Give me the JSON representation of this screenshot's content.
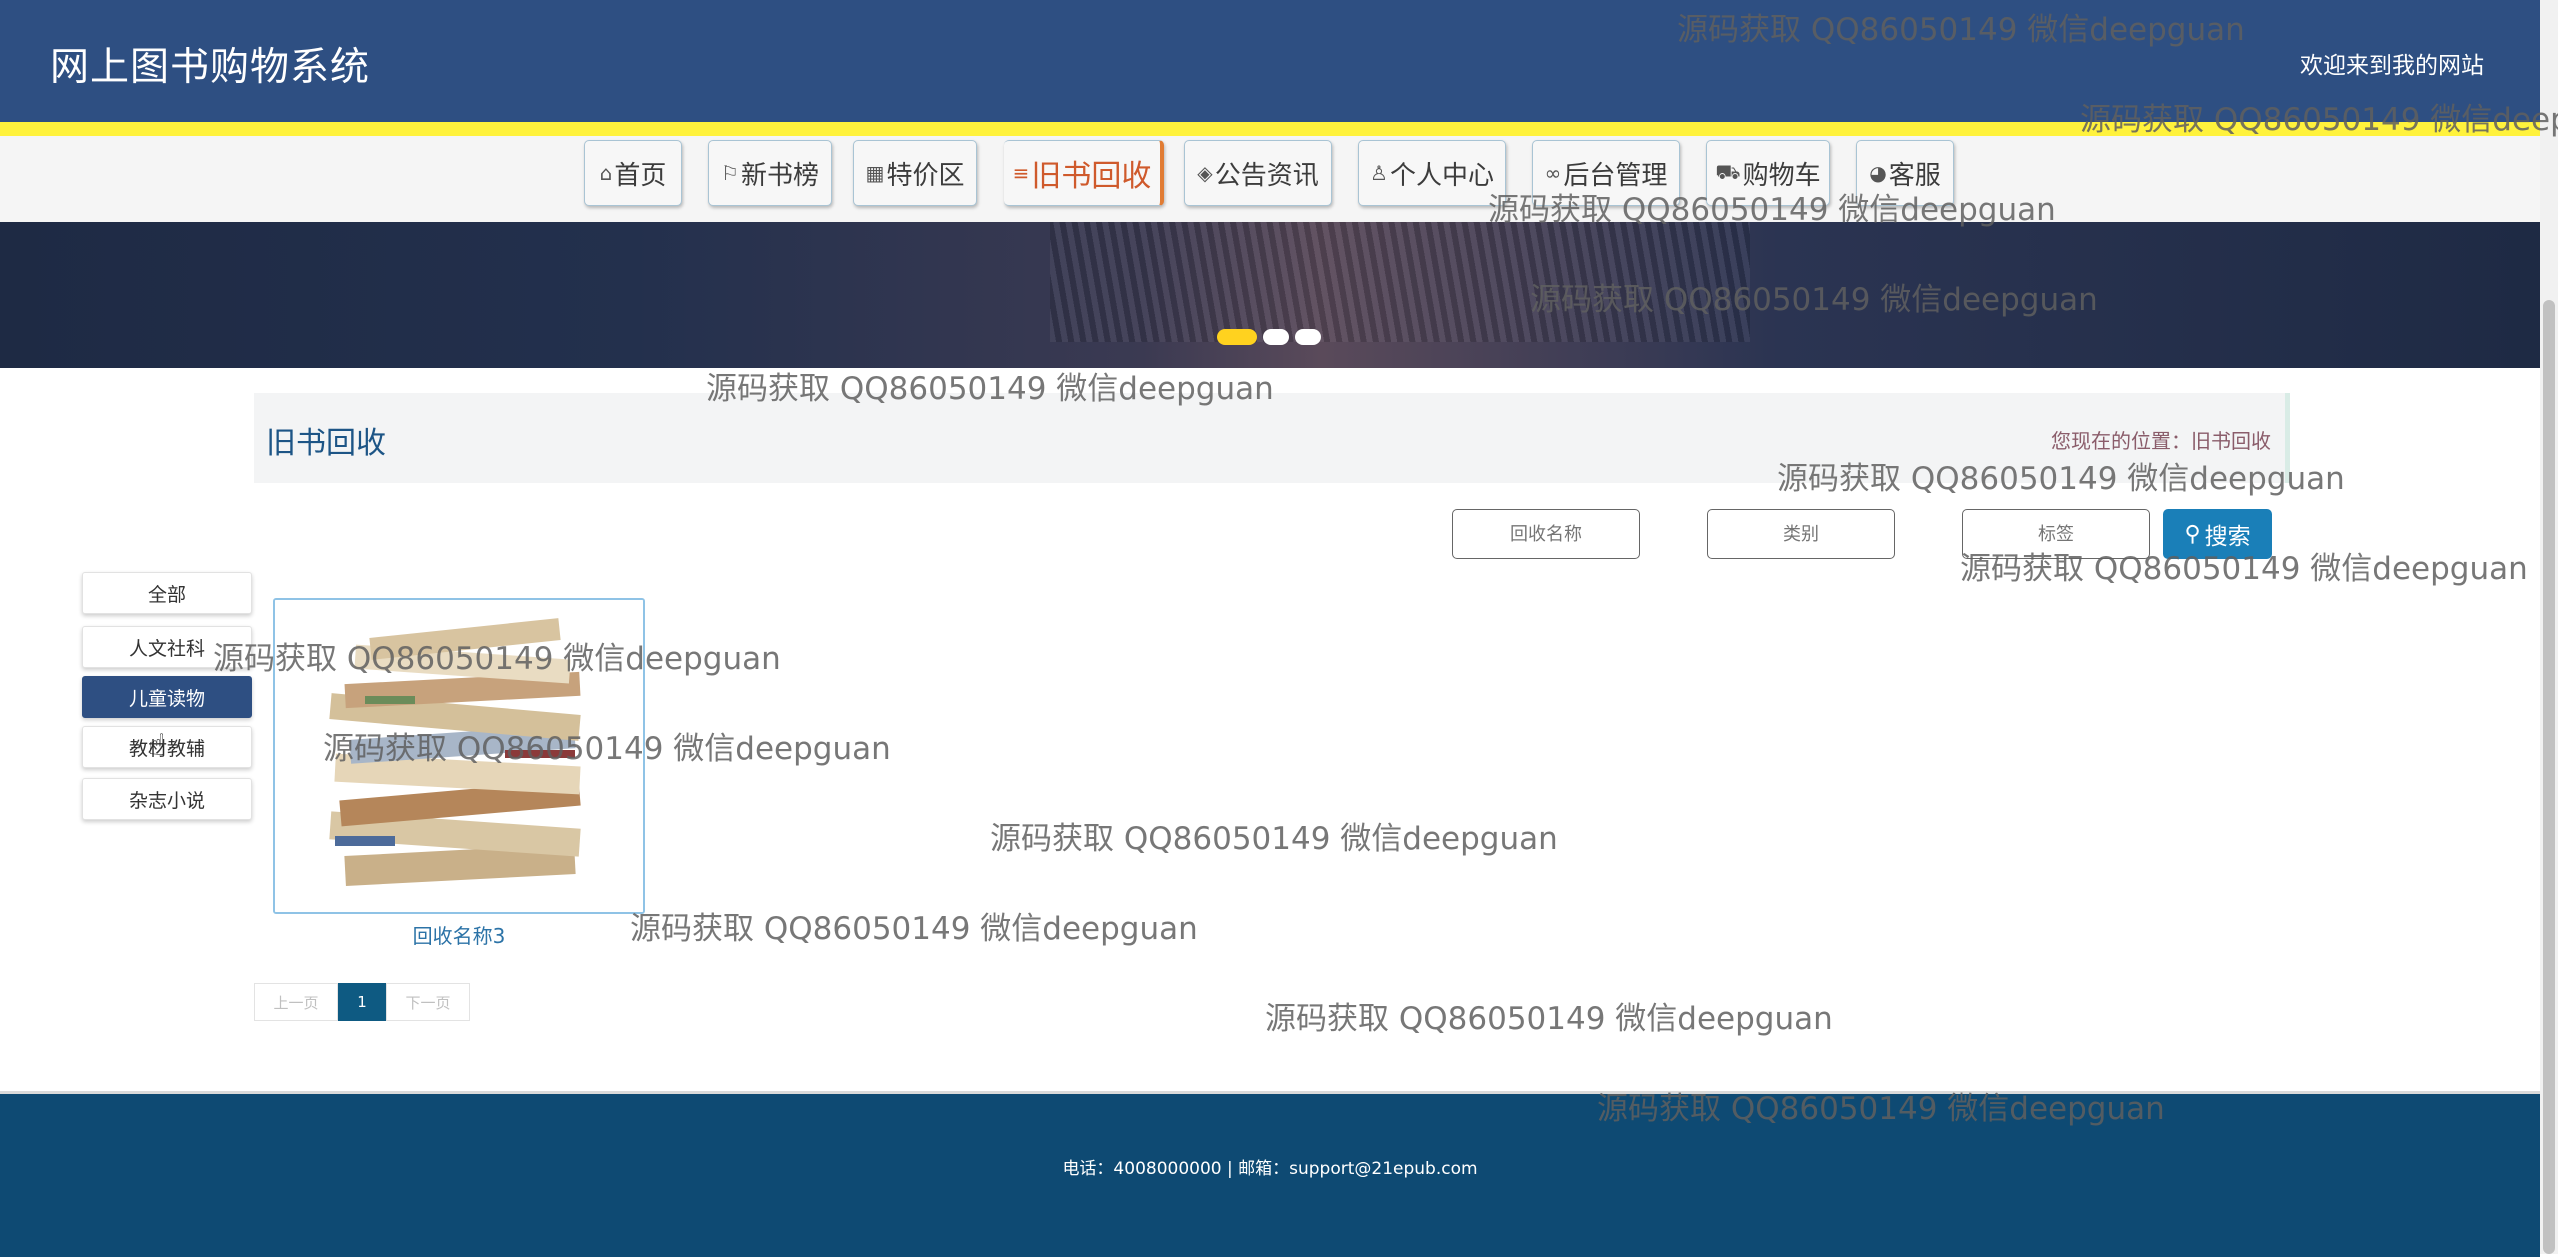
{
  "header": {
    "site_title": "网上图书购物系统",
    "welcome": "欢迎来到我的网站"
  },
  "nav": {
    "items": [
      {
        "label": "首页",
        "icon": "home-icon"
      },
      {
        "label": "新书榜",
        "icon": "flag-icon"
      },
      {
        "label": "特价区",
        "icon": "grid-icon"
      },
      {
        "label": "旧书回收",
        "icon": "sliders-icon",
        "active": true
      },
      {
        "label": "公告资讯",
        "icon": "layers-icon"
      },
      {
        "label": "个人中心",
        "icon": "user-icon"
      },
      {
        "label": "后台管理",
        "icon": "link-icon"
      },
      {
        "label": "购物车",
        "icon": "cart-icon"
      },
      {
        "label": "客服",
        "icon": "chat-icon"
      }
    ]
  },
  "banner": {
    "slide_count": 3,
    "active_slide": 1
  },
  "page": {
    "title": "旧书回收",
    "location": "您现在的位置：旧书回收"
  },
  "search": {
    "name_placeholder": "回收名称",
    "category_placeholder": "类别",
    "tag_placeholder": "标签",
    "button_label": "搜索"
  },
  "categories": [
    {
      "label": "全部"
    },
    {
      "label": "人文社科"
    },
    {
      "label": "儿童读物",
      "active": true
    },
    {
      "label": "教材教辅"
    },
    {
      "label": "杂志小说"
    }
  ],
  "products": [
    {
      "name": "回收名称3",
      "image": "stack-of-books-image"
    }
  ],
  "pagination": {
    "prev": "上一页",
    "current": "1",
    "next": "下一页"
  },
  "footer": {
    "contact": "电话：4008000000 | 邮箱：support@21epub.com"
  },
  "watermark": {
    "text": "源码获取 QQ86050149 微信deepguan"
  },
  "colors": {
    "header_bg": "#2e4f82",
    "accent_yellow": "#fff23c",
    "active_nav": "#cf5a2c",
    "search_button": "#1a7fb8",
    "footer_bg": "#0e4a73"
  }
}
